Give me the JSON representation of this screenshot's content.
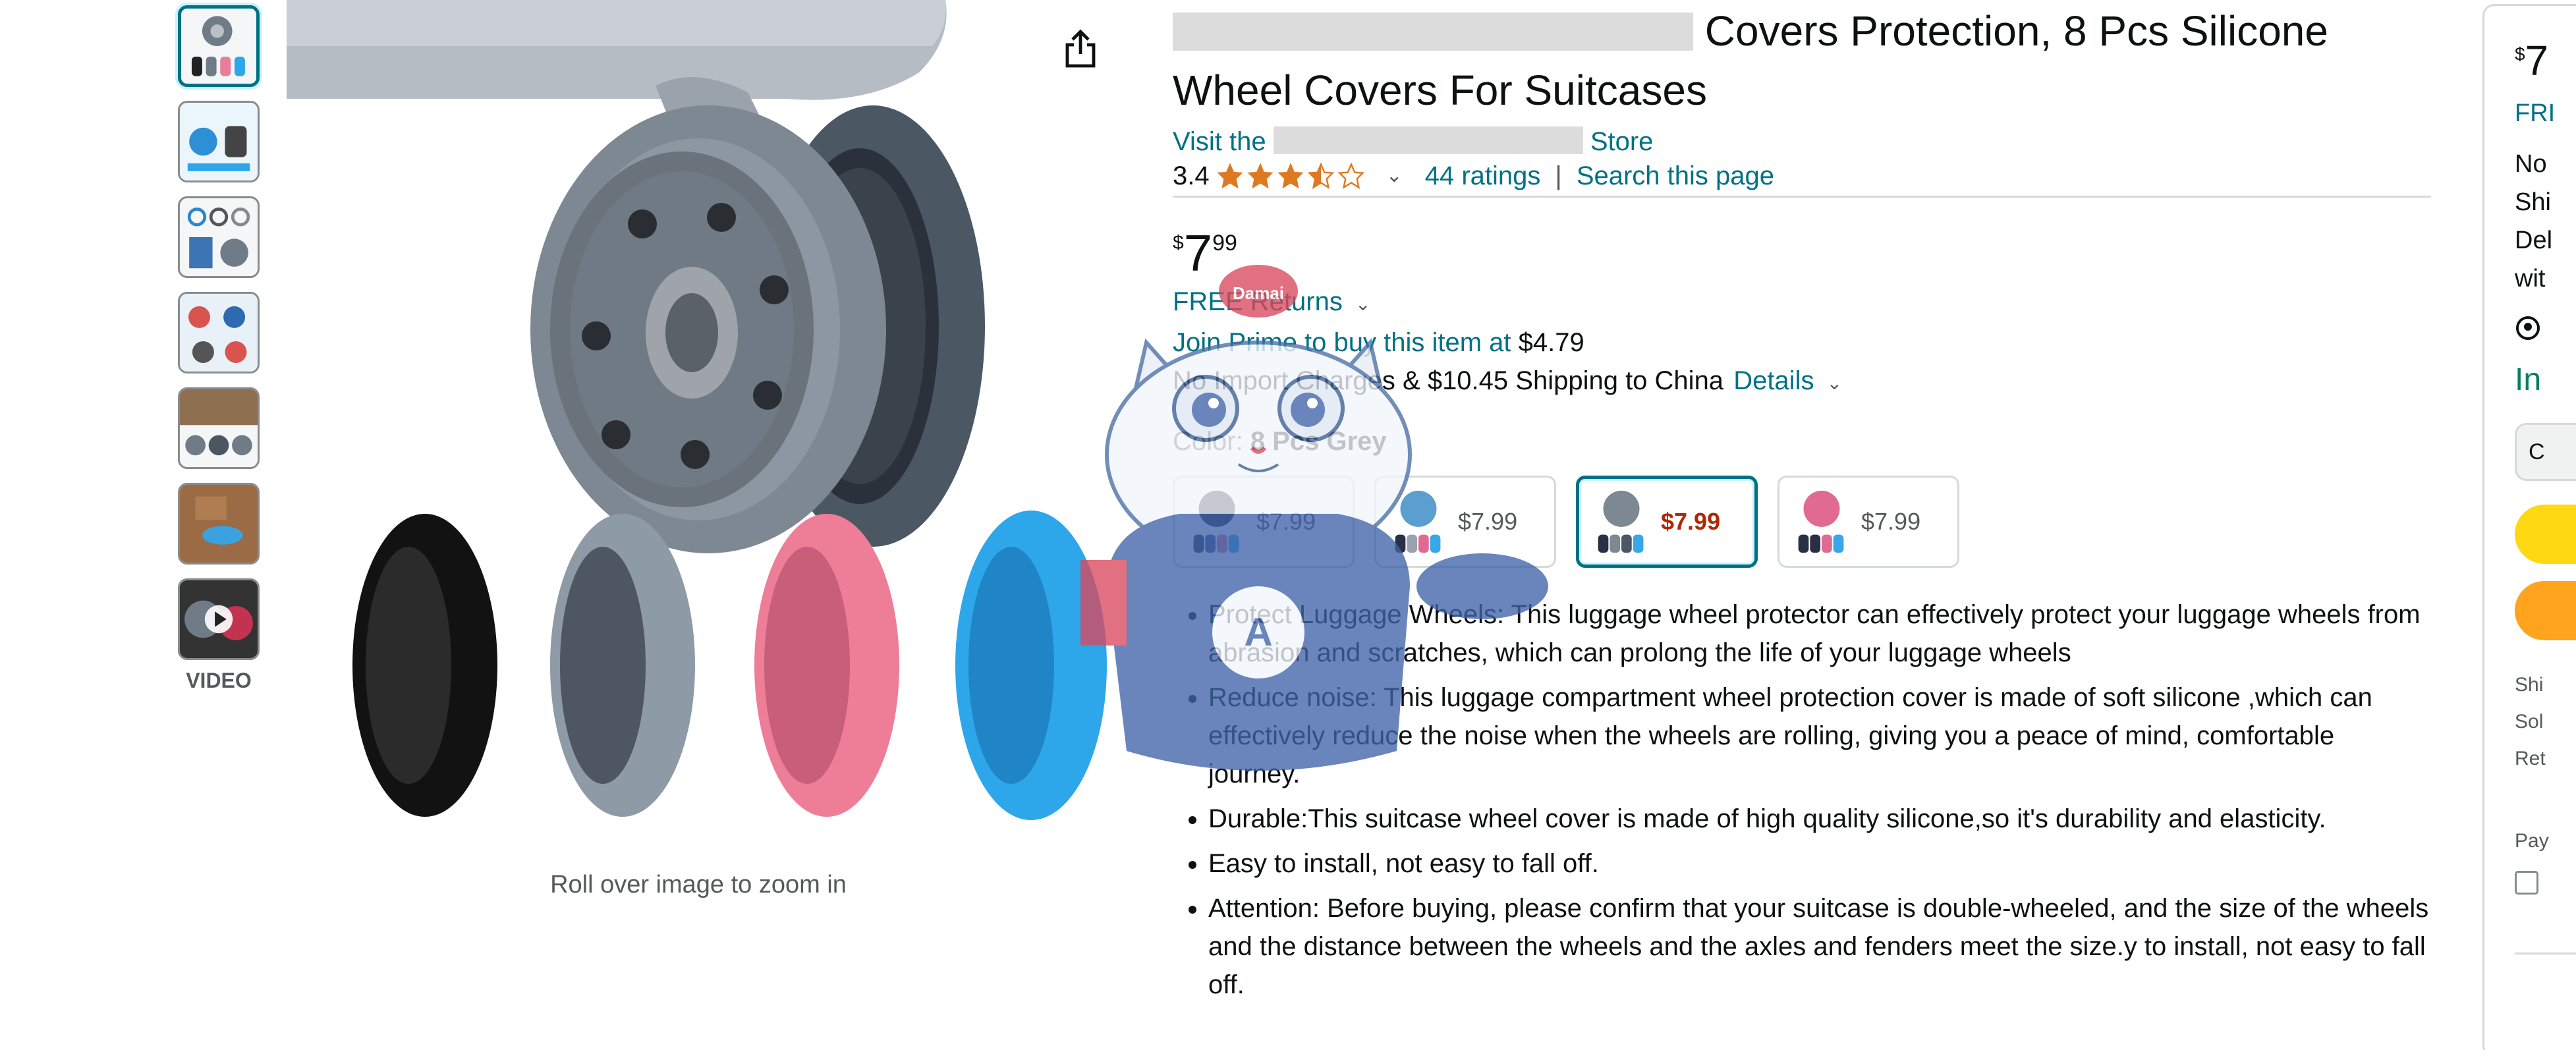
{
  "thumbnails": [
    {
      "name": "thumbnail-1",
      "selected": true
    },
    {
      "name": "thumbnail-2",
      "selected": false
    },
    {
      "name": "thumbnail-3",
      "selected": false
    },
    {
      "name": "thumbnail-4",
      "selected": false
    },
    {
      "name": "thumbnail-5",
      "selected": false
    },
    {
      "name": "thumbnail-6",
      "selected": false
    },
    {
      "name": "thumbnail-video",
      "selected": false
    }
  ],
  "video_label": "VIDEO",
  "zoom_hint": "Roll over image to zoom in",
  "product": {
    "title_visible": "Covers Protection, 8 Pcs Silicone Wheel Covers For Suitcases",
    "store_link_prefix": "Visit the",
    "store_link_suffix": "Store",
    "rating_value": "3.4",
    "rating_stars": 3.5,
    "ratings_count": "44 ratings",
    "search_page": "Search this page",
    "rating_separator": "|",
    "price_symbol": "$",
    "price_whole": "7",
    "price_fraction": "99",
    "free_returns": "FREE Returns",
    "prime_text": "Join Prime to buy this item at",
    "prime_price": "$4.79",
    "import_text": "No Import Charges & $10.45 Shipping to China",
    "details_link": "Details",
    "color_label": "Color:",
    "color_value": "8 Pcs Grey"
  },
  "swatches": [
    {
      "price": "$7.99",
      "selected": false,
      "colors": [
        "#2a2f45",
        "#3e4a8a",
        "#e06a92",
        "#38a7e8"
      ]
    },
    {
      "price": "$7.99",
      "selected": false,
      "colors": [
        "#2a2f45",
        "#9aa3ad",
        "#e06a92",
        "#38a7e8"
      ]
    },
    {
      "price": "$7.99",
      "selected": true,
      "colors": [
        "#2a2f45",
        "#7d8893",
        "#4c5664",
        "#38a7e8"
      ]
    },
    {
      "price": "$7.99",
      "selected": false,
      "colors": [
        "#e06a92",
        "#2a2f45",
        "#e06a92",
        "#38a7e8"
      ]
    }
  ],
  "bullets": [
    "Protect Luggage Wheels:  This luggage wheel protector can effectively protect your luggage wheels from abrasion and scratches, which can prolong the life of your luggage wheels",
    "Reduce noise: This luggage compartment wheel protection cover is made of soft silicone ,which can effectively reduce the noise when the wheels are rolling, giving you a peace of mind, comfortable journey.",
    "Durable:This suitcase wheel cover is made of high quality silicone,so it's durability and elasticity.",
    "Easy to install, not easy to fall off.",
    "Attention: Before buying, please confirm that your suitcase is double-wheeled, and the size of the wheels and the distance between the wheels and the axles and fenders meet the size.y to install, not easy to fall off."
  ],
  "buybox": {
    "price_symbol": "$",
    "price_whole_partial": "7",
    "free_partial": "FRI",
    "lines_partial": [
      "No",
      "Shi",
      "Del",
      "wit"
    ],
    "stock_partial": "In",
    "qty_partial": "C",
    "small_partial": [
      "Shi",
      "Sol",
      "Ret"
    ],
    "pay_partial": "Pay"
  },
  "mascot": {
    "badge_text": "Damai"
  },
  "colors": {
    "link": "#007185",
    "price_selected": "#b12704",
    "star": "#de7921",
    "in_stock": "#067d62",
    "add_to_cart": "#ffd814",
    "buy_now": "#ffa41c"
  }
}
